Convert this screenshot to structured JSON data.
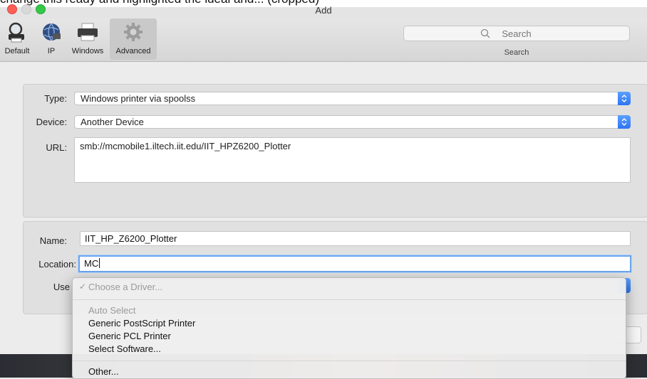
{
  "caption": "change this ready and highlighted the ideal and... (cropped)",
  "window": {
    "title": "Add"
  },
  "toolbar": {
    "buttons": [
      {
        "label": "Default",
        "icon": "printer-magnifier-icon"
      },
      {
        "label": "IP",
        "icon": "globe-icon"
      },
      {
        "label": "Windows",
        "icon": "printer-icon"
      },
      {
        "label": "Advanced",
        "icon": "gear-icon",
        "selected": true
      }
    ],
    "search": {
      "placeholder": "Search",
      "label": "Search"
    }
  },
  "form": {
    "type": {
      "label": "Type:",
      "value": "Windows printer via spoolss"
    },
    "device": {
      "label": "Device:",
      "value": "Another Device"
    },
    "url": {
      "label": "URL:",
      "value": "smb://mcmobile1.iltech.iit.edu/IIT_HPZ6200_Plotter"
    },
    "name": {
      "label": "Name:",
      "value": "IIT_HP_Z6200_Plotter"
    },
    "location": {
      "label": "Location:",
      "value": "MC"
    },
    "use": {
      "label": "Use"
    }
  },
  "menu": {
    "items": [
      {
        "label": "Choose a Driver...",
        "checked": true,
        "disabled": true
      },
      {
        "label": "Auto Select",
        "disabled": true
      },
      {
        "label": "Generic PostScript Printer"
      },
      {
        "label": "Generic PCL Printer"
      },
      {
        "label": "Select Software..."
      },
      {
        "label": "Other..."
      }
    ]
  },
  "colors": {
    "accent": "#2e74f3",
    "focus_ring": "#6aa5ef",
    "close": "#fc5f57",
    "maximize": "#34c84a"
  }
}
